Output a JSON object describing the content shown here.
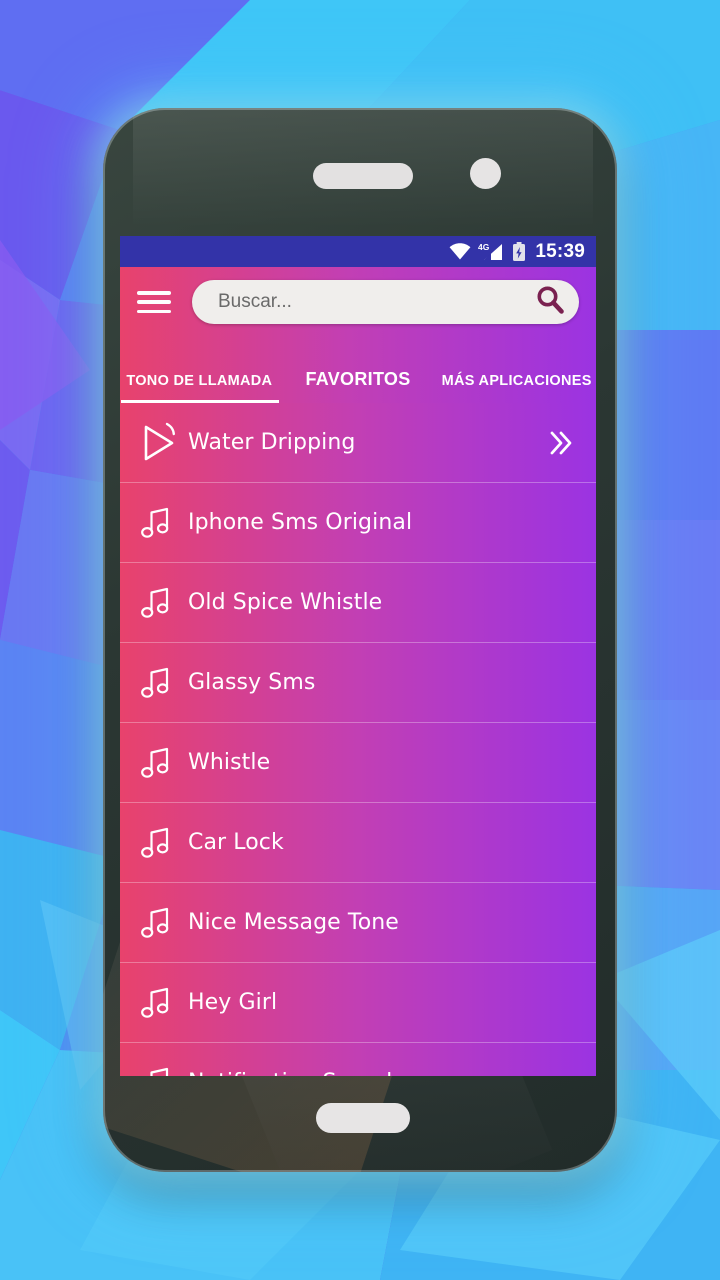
{
  "statusbar": {
    "time": "15:39",
    "network_label": "4G",
    "icons": [
      "wifi-icon",
      "signal-4g-icon",
      "battery-charging-icon"
    ]
  },
  "appbar": {
    "menu_icon": "hamburger-menu-icon",
    "search": {
      "placeholder": "Buscar...",
      "value": "",
      "icon": "search-icon"
    }
  },
  "tabs": [
    {
      "label": "TONO DE LLAMADA",
      "active": true
    },
    {
      "label": "FAVORITOS",
      "active": false
    },
    {
      "label": "MÁS APLICACIONES",
      "active": false
    }
  ],
  "list": {
    "items": [
      {
        "label": "Water Dripping",
        "icon": "play-icon",
        "more_icon": "double-chevron-right-icon",
        "playing": true
      },
      {
        "label": "Iphone Sms Original",
        "icon": "music-note-icon",
        "more_icon": "",
        "playing": false
      },
      {
        "label": "Old Spice Whistle",
        "icon": "music-note-icon",
        "more_icon": "",
        "playing": false
      },
      {
        "label": "Glassy Sms",
        "icon": "music-note-icon",
        "more_icon": "",
        "playing": false
      },
      {
        "label": "Whistle",
        "icon": "music-note-icon",
        "more_icon": "",
        "playing": false
      },
      {
        "label": "Car Lock",
        "icon": "music-note-icon",
        "more_icon": "",
        "playing": false
      },
      {
        "label": "Nice Message Tone",
        "icon": "music-note-icon",
        "more_icon": "",
        "playing": false
      },
      {
        "label": "Hey Girl",
        "icon": "music-note-icon",
        "more_icon": "",
        "playing": false
      },
      {
        "label": "Notification Sound",
        "icon": "music-note-icon",
        "more_icon": "",
        "playing": false
      }
    ]
  },
  "device": {
    "earpiece": "earpiece-speaker",
    "camera": "front-camera",
    "home_button": "home-button"
  },
  "colors": {
    "statusbar_bg": "#3333a8",
    "gradient_start": "#e8426c",
    "gradient_mid": "#c23fb4",
    "gradient_end": "#9b33e2",
    "search_bg": "#f0eeec",
    "search_icon": "#7a2150",
    "accent_white": "#ffffff",
    "bezel": "#2b3733"
  }
}
